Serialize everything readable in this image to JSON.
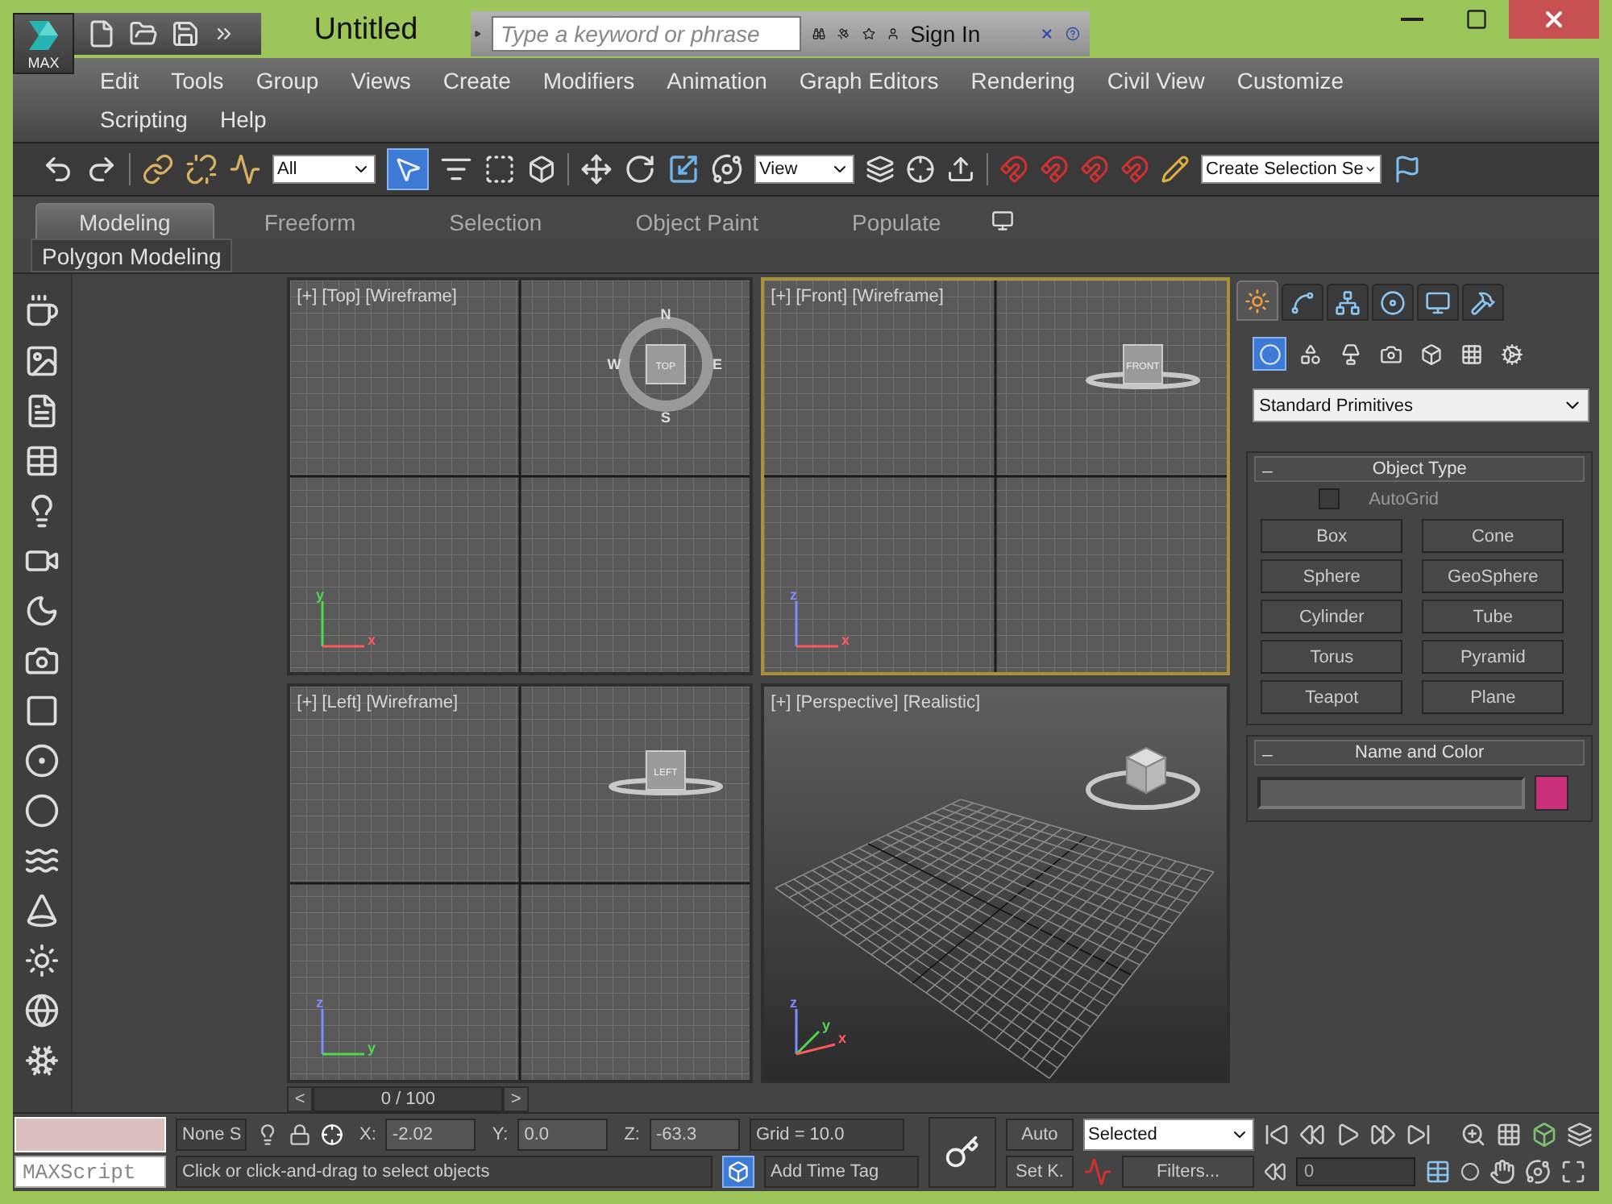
{
  "window": {
    "app_label": "MAX",
    "title": "Untitled",
    "search": {
      "placeholder": "Type a keyword or phrase"
    },
    "sign_in": "Sign In"
  },
  "menu": [
    "Edit",
    "Tools",
    "Group",
    "Views",
    "Create",
    "Modifiers",
    "Animation",
    "Graph Editors",
    "Rendering",
    "Civil View",
    "Customize",
    "Scripting",
    "Help"
  ],
  "toolbar": {
    "selection_filter": "All",
    "select_object": {
      "selected": true
    },
    "reference_coord": "View",
    "named_selection": "Create Selection Se"
  },
  "ribbon": {
    "tabs": [
      {
        "label": "Modeling",
        "selected": true
      },
      {
        "label": "Freeform",
        "selected": false
      },
      {
        "label": "Selection",
        "selected": false
      },
      {
        "label": "Object Paint",
        "selected": false
      },
      {
        "label": "Populate",
        "selected": false
      }
    ],
    "panel": "Polygon Modeling"
  },
  "viewports": [
    {
      "label": "[+] [Top] [Wireframe]",
      "kind": "ortho",
      "active": false,
      "cube_face": "TOP",
      "compass": [
        "N",
        "W",
        "E",
        "S"
      ],
      "axes": [
        "y",
        "x"
      ]
    },
    {
      "label": "[+] [Front] [Wireframe]",
      "kind": "ortho",
      "active": true,
      "cube_face": "FRONT",
      "axes": [
        "z",
        "x"
      ]
    },
    {
      "label": "[+] [Left] [Wireframe]",
      "kind": "ortho",
      "active": false,
      "cube_face": "LEFT",
      "axes": [
        "z",
        "y"
      ]
    },
    {
      "label": "[+] [Perspective] [Realistic]",
      "kind": "perspective",
      "active": false,
      "axes": [
        "z",
        "y",
        "x"
      ]
    }
  ],
  "time_slider": {
    "prev": "<",
    "position": "0 / 100",
    "next": ">"
  },
  "command_panel": {
    "tabs": [
      {
        "selected": true
      },
      {
        "selected": false
      },
      {
        "selected": false
      },
      {
        "selected": false
      },
      {
        "selected": false
      },
      {
        "selected": false
      }
    ],
    "categories": [
      {
        "selected": true
      },
      {
        "selected": false
      },
      {
        "selected": false
      },
      {
        "selected": false
      },
      {
        "selected": false
      },
      {
        "selected": false
      },
      {
        "selected": false
      }
    ],
    "dropdown": "Standard Primitives",
    "object_type": {
      "collapse": "_",
      "title": "Object Type",
      "autogrid": {
        "label": "AutoGrid",
        "checked": false
      },
      "buttons": [
        "Box",
        "Cone",
        "Sphere",
        "GeoSphere",
        "Cylinder",
        "Tube",
        "Torus",
        "Pyramid",
        "Teapot",
        "Plane"
      ]
    },
    "name_and_color": {
      "collapse": "_",
      "title": "Name and Color",
      "color": "#c8317a"
    }
  },
  "status": {
    "listener": "MAXScript",
    "selection": "None S",
    "coords": [
      {
        "label": "X:",
        "value": "-2.02"
      },
      {
        "label": "Y:",
        "value": "0.0"
      },
      {
        "label": "Z:",
        "value": "-63.3"
      }
    ],
    "grid": "Grid = 10.0",
    "prompt": "Click or click-and-drag to select objects",
    "time_tag": "Add Time Tag",
    "auto_key": "Auto",
    "set_key": "Set K.",
    "key_filter": "Selected",
    "filters": "Filters...",
    "frame": "0"
  }
}
